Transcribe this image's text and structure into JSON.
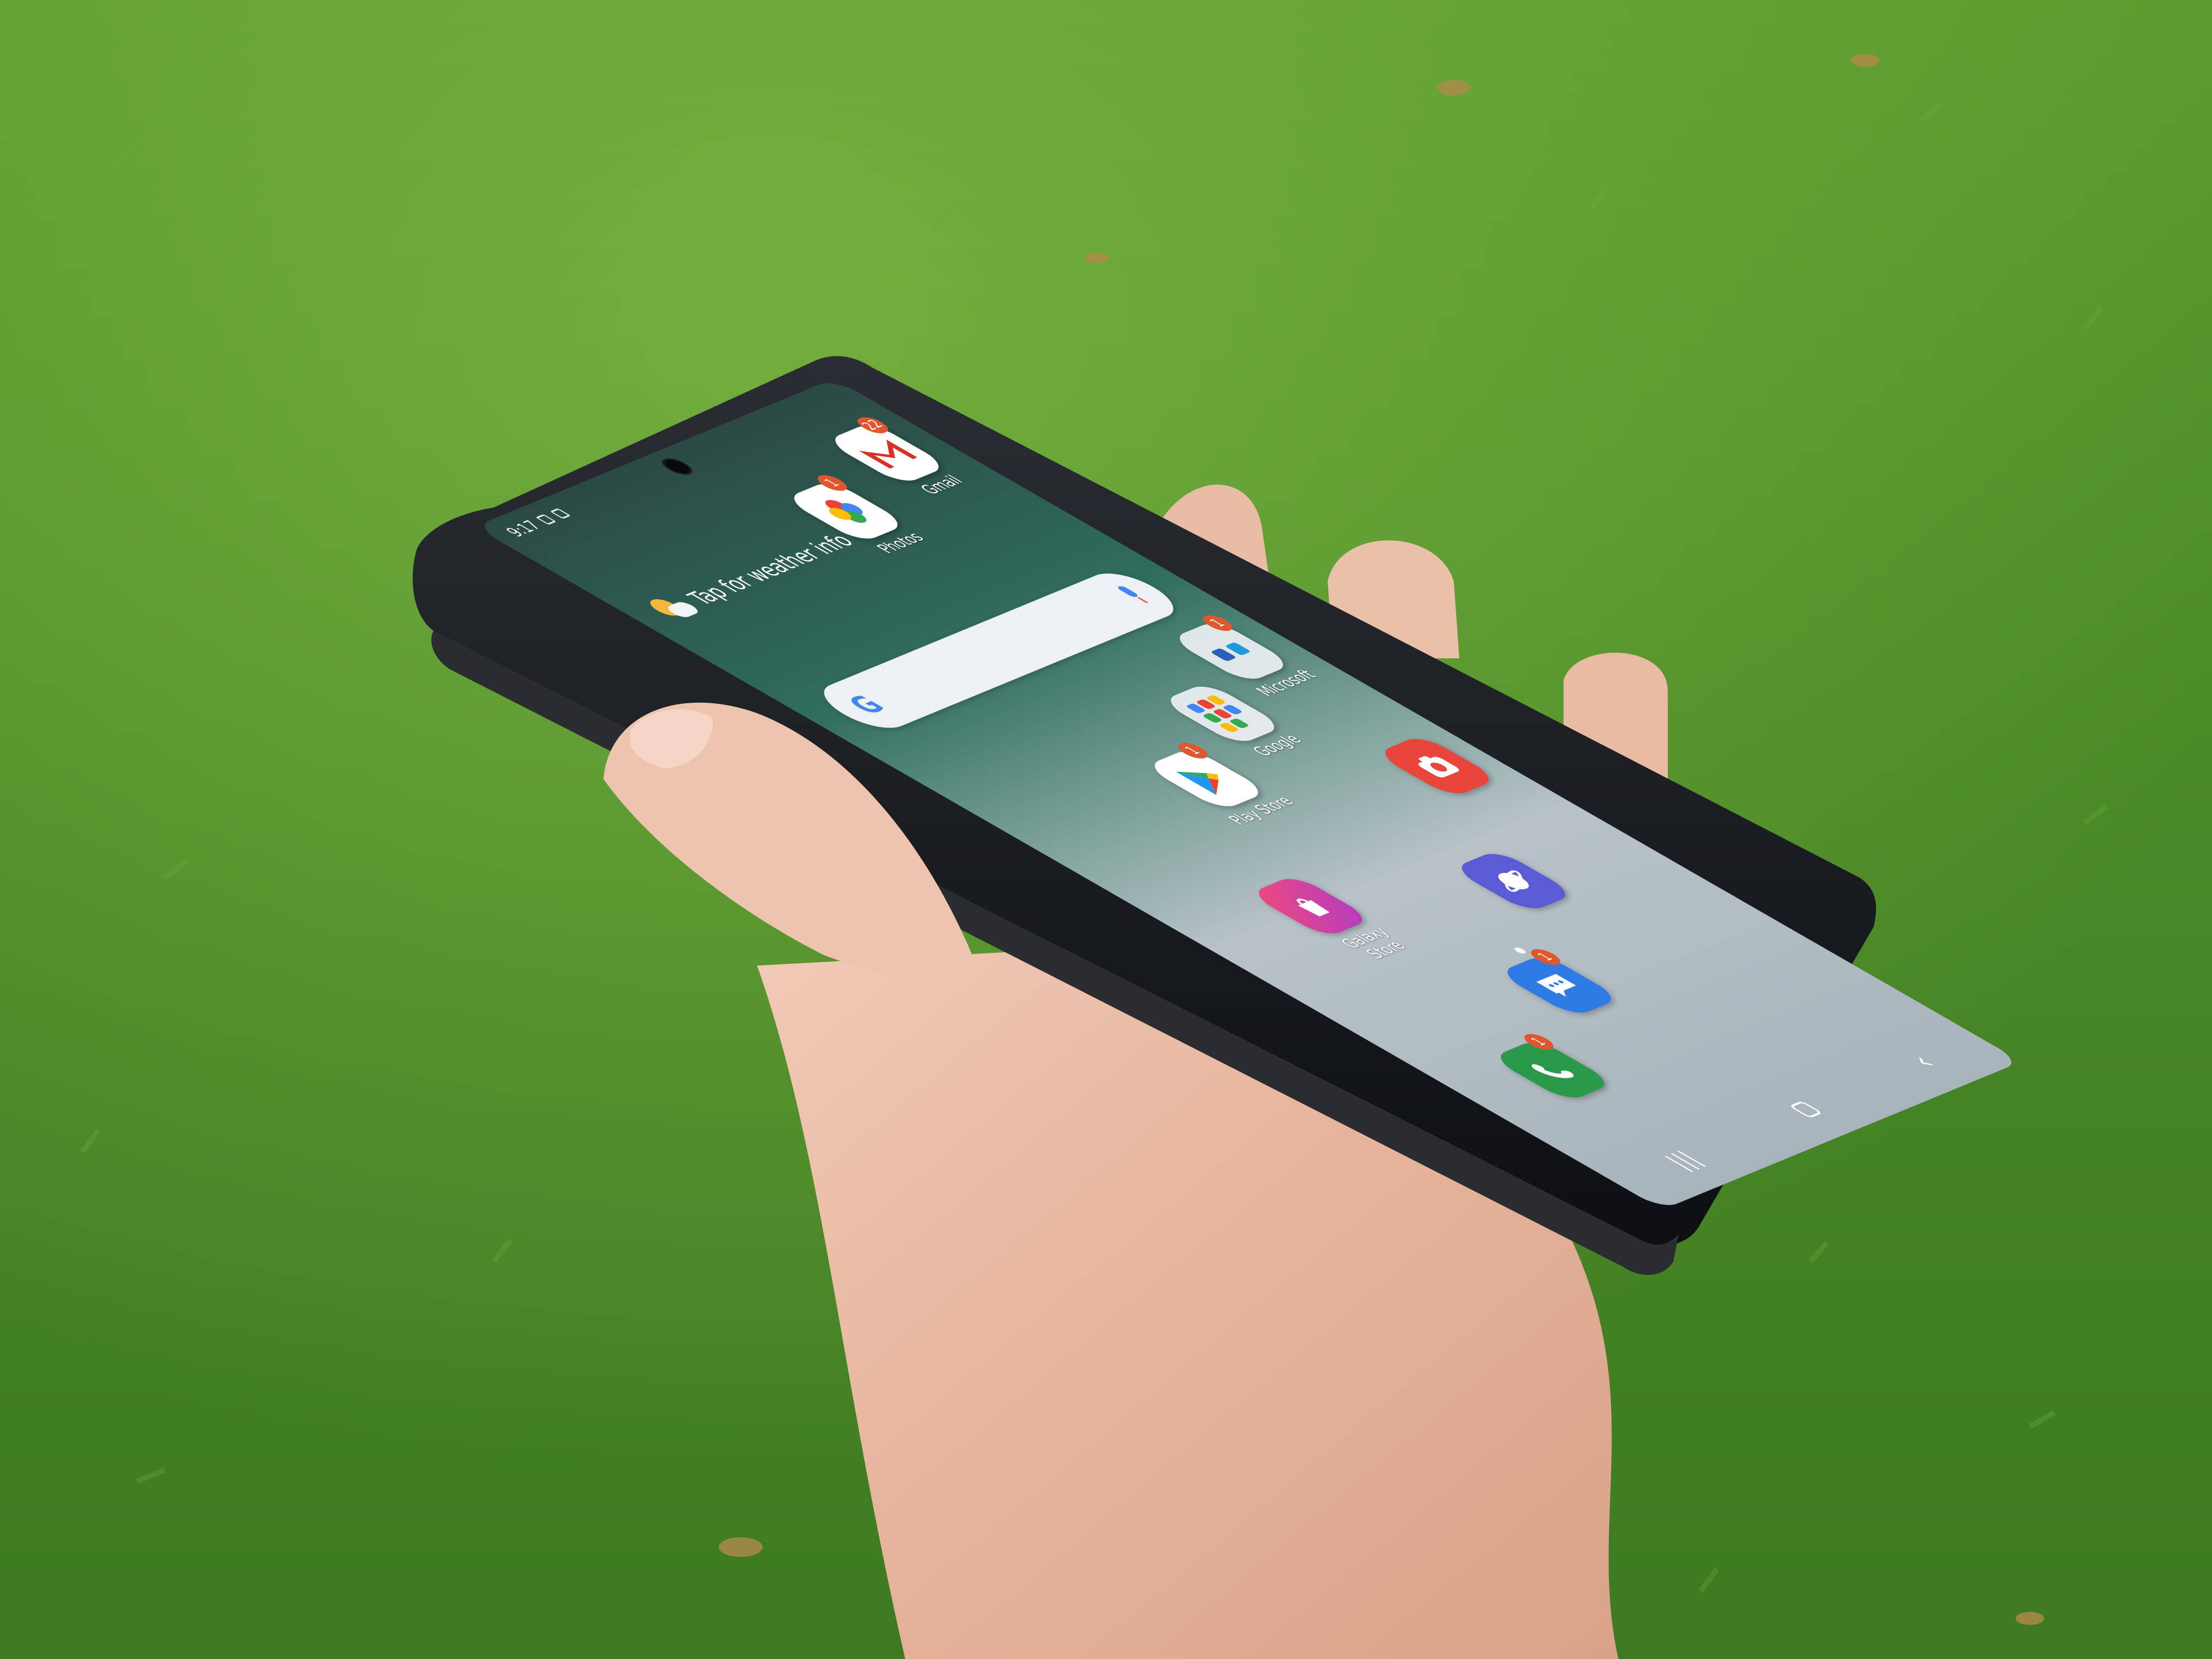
{
  "status_bar": {
    "time": "9:17"
  },
  "weather": {
    "text": "Tap for weather info"
  },
  "apps": {
    "photos": {
      "label": "Photos",
      "badge": "1"
    },
    "gmail": {
      "label": "Gmail",
      "badge": "22"
    },
    "microsoft": {
      "label": "Microsoft",
      "badge": "1"
    },
    "google": {
      "label": "Google"
    },
    "play_store": {
      "label": "Play Store",
      "badge": "1"
    },
    "galaxy_store": {
      "label": "Galaxy Store"
    },
    "messages": {
      "badge": "1"
    },
    "phone": {
      "badge": "1"
    }
  },
  "search_bar": {
    "logo": "G"
  },
  "icons": [
    "weather-icon",
    "google-logo-icon",
    "mic-icon",
    "camera-app-icon",
    "internet-icon",
    "messages-icon",
    "phone-icon",
    "back-icon",
    "home-icon",
    "recents-icon"
  ],
  "colors": {
    "grass": "#4f8f2b",
    "badge": "#e0562e",
    "gmail_red": "#d93025",
    "camera_red": "#e8463a",
    "internet_purple": "#5c5bd6",
    "messages_blue": "#2f7be6",
    "phone_green": "#2a9a4a",
    "galaxy_store_pink": "#d83a8c"
  }
}
